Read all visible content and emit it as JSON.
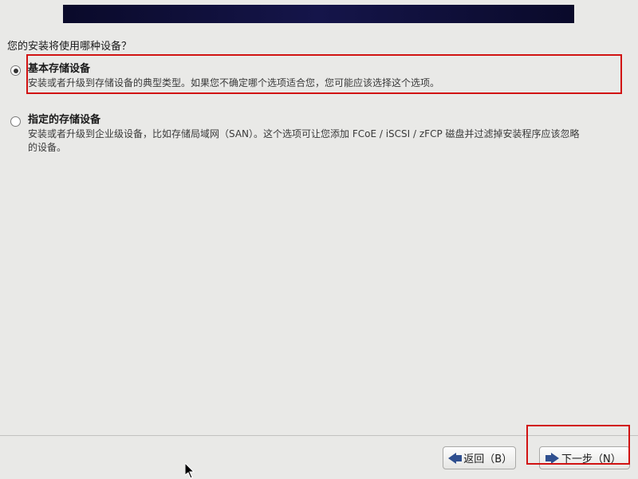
{
  "prompt": "您的安装将使用哪种设备？",
  "options": [
    {
      "title": "基本存储设备",
      "desc": "安装或者升级到存储设备的典型类型。如果您不确定哪个选项适合您，您可能应该选择这个选项。",
      "selected": true,
      "highlighted": true
    },
    {
      "title": "指定的存储设备",
      "desc": "安装或者升级到企业级设备，比如存储局域网（SAN）。这个选项可让您添加 FCoE / iSCSI / zFCP 磁盘并过滤掉安装程序应该忽略的设备。",
      "selected": false,
      "highlighted": false
    }
  ],
  "buttons": {
    "back": "返回（B）",
    "next": "下一步（N）"
  }
}
